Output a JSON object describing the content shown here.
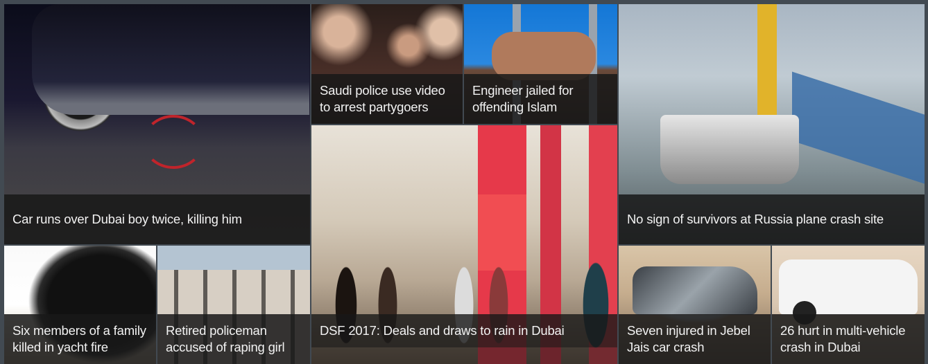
{
  "stories": [
    {
      "title": "Car runs over Dubai boy twice, killing him",
      "image": "car-bicycle-accident-photo"
    },
    {
      "title": "Saudi police use video to arrest partygoers",
      "image": "partygoers-photo"
    },
    {
      "title": "Engineer jailed for offending Islam",
      "image": "hands-on-prison-bars-photo"
    },
    {
      "title": "No sign of survivors at Russia plane crash site",
      "image": "rescue-boats-pier-photo"
    },
    {
      "title": "DSF 2017: Deals and draws to rain in Dubai",
      "image": "shopping-mall-sale-photo"
    },
    {
      "title": "Six members of a family killed in yacht fire",
      "image": "black-smoke-photo"
    },
    {
      "title": "Retired policeman accused of raping girl",
      "image": "police-building-photo"
    },
    {
      "title": "Seven injured in Jebel Jais car crash",
      "image": "wrecked-car-photo"
    },
    {
      "title": "26 hurt in multi-vehicle crash in Dubai",
      "image": "damaged-van-photo"
    }
  ]
}
